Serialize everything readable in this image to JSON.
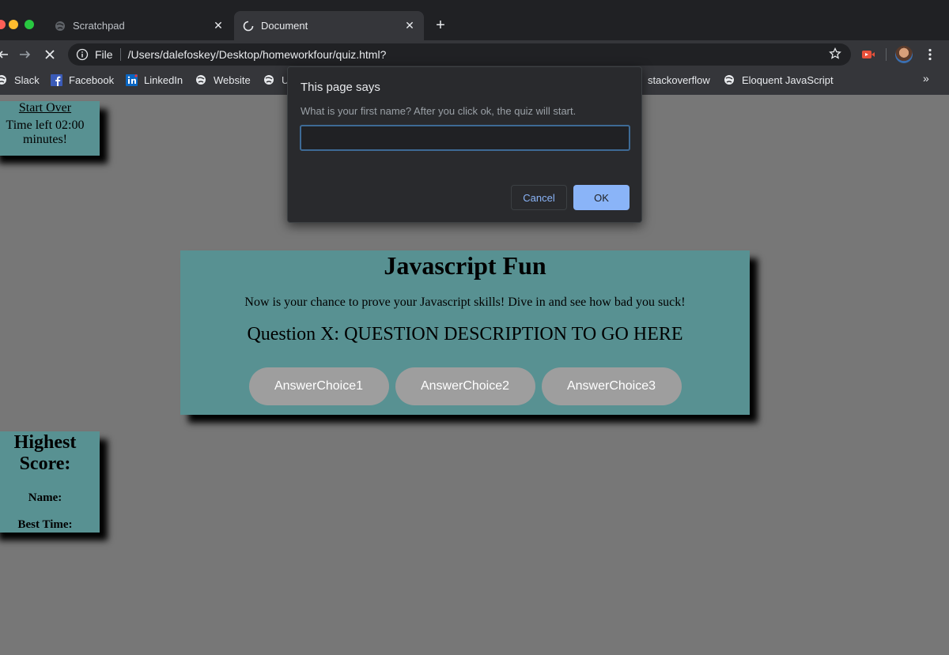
{
  "browser": {
    "tabs": [
      {
        "title": "Scratchpad",
        "favicon": "globe-icon",
        "active": false
      },
      {
        "title": "Document",
        "favicon": "loading-spinner-icon",
        "active": true
      }
    ],
    "address": {
      "scheme": "File",
      "url": "/Users/dalefoskey/Desktop/homeworkfour/quiz.html?"
    },
    "bookmarks": [
      {
        "label": "Slack",
        "icon": "globe-icon"
      },
      {
        "label": "Facebook",
        "icon": "facebook-icon"
      },
      {
        "label": "LinkedIn",
        "icon": "linkedin-icon"
      },
      {
        "label": "Website",
        "icon": "globe-icon"
      },
      {
        "label": "U",
        "icon": "globe-icon"
      },
      {
        "label": "stackoverflow",
        "icon": "stackoverflow-icon"
      },
      {
        "label": "Eloquent JavaScript",
        "icon": "globe-icon"
      }
    ],
    "bookmarks_more": "»"
  },
  "timer": {
    "start_over": "Start Over",
    "time_left": "Time left 02:00 minutes!"
  },
  "scores": {
    "title": "Highest Score:",
    "name_label": "Name:",
    "best_time_label": "Best Time:"
  },
  "quiz": {
    "title": "Javascript Fun",
    "intro": "Now is your chance to prove your Javascript skills! Dive in and see how bad you suck!",
    "question": "Question X: QUESTION DESCRIPTION TO GO HERE",
    "answers": [
      "AnswerChoice1",
      "AnswerChoice2",
      "AnswerChoice3"
    ]
  },
  "dialog": {
    "title": "This page says",
    "message": "What is your first name? After you click ok, the quiz will start.",
    "input_value": "",
    "cancel_label": "Cancel",
    "ok_label": "OK"
  },
  "colors": {
    "page_bg": "#777777",
    "panel": "#589192",
    "answer_button": "#9e9e9e",
    "dialog_ok": "#8ab4f8"
  }
}
